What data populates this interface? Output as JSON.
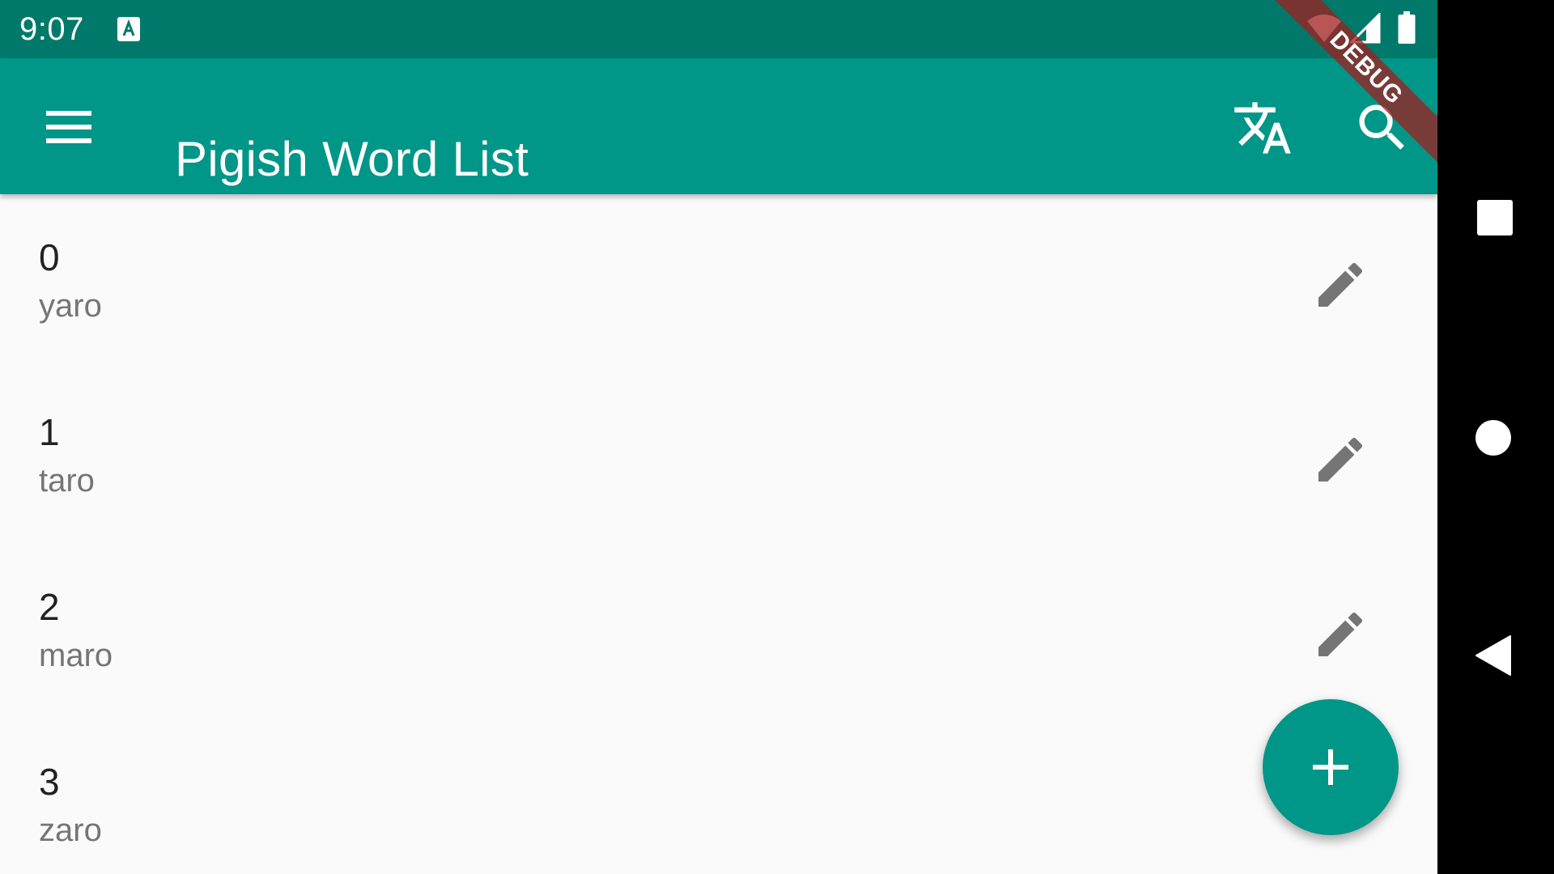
{
  "status_bar": {
    "time": "9:07",
    "icons": [
      "notification-a-icon",
      "wifi-icon",
      "signal-icon",
      "battery-icon"
    ]
  },
  "app_bar": {
    "title": "Pigish Word List",
    "actions": [
      "menu-icon",
      "translate-icon",
      "search-icon"
    ],
    "background": "#009688",
    "status_background": "#00796b"
  },
  "debug_banner": {
    "label": "DEBUG"
  },
  "words": [
    {
      "number": "0",
      "translation": "yaro"
    },
    {
      "number": "1",
      "translation": "taro"
    },
    {
      "number": "2",
      "translation": "maro"
    },
    {
      "number": "3",
      "translation": "zaro"
    }
  ],
  "fab": {
    "icon": "add-icon",
    "color": "#009688"
  },
  "nav_bar": {
    "buttons": [
      "recents-icon",
      "home-icon",
      "back-icon"
    ]
  }
}
